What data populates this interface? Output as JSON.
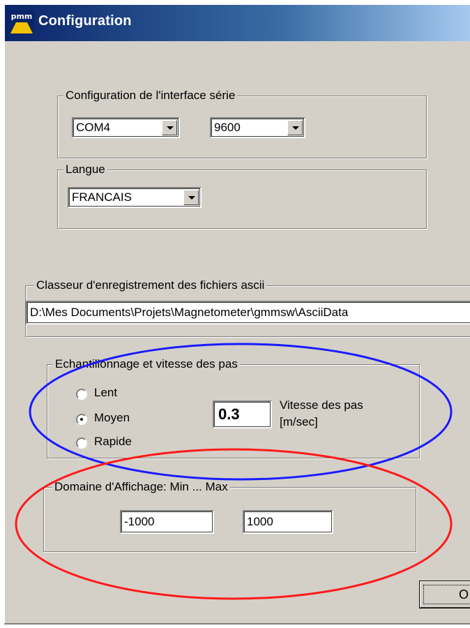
{
  "window": {
    "title": "Configuration",
    "app_icon_text": "pmm"
  },
  "serial": {
    "legend": "Configuration de l'interface série",
    "port": "COM4",
    "baud": "9600"
  },
  "language": {
    "legend": "Langue",
    "value": "FRANCAIS"
  },
  "folder": {
    "legend": "Classeur d'enregistrement des fichiers ascii",
    "path": "D:\\Mes Documents\\Projets\\Magnetometer\\gmmsw\\AsciiData"
  },
  "sampling": {
    "legend": "Echantillonnage et vitesse des pas",
    "options": [
      "Lent",
      "Moyen",
      "Rapide"
    ],
    "selected": "Moyen",
    "speed_value": "0.3",
    "speed_label_1": "Vitesse des pas",
    "speed_label_2": "[m/sec]"
  },
  "display": {
    "legend": "Domaine d'Affichage:  Min ... Max",
    "min": "-1000",
    "max": "1000"
  },
  "buttons": {
    "ok_label": "O"
  },
  "colors": {
    "annotation_blue": "#1a1aff",
    "annotation_red": "#ff1a1a",
    "dialog_bg": "#d4d0c8"
  }
}
